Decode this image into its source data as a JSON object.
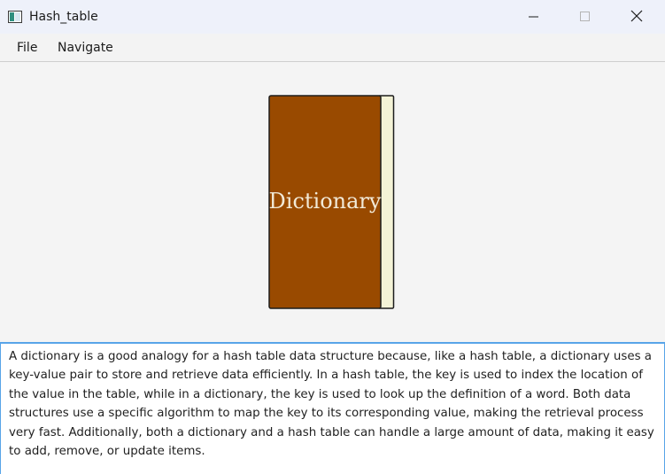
{
  "window": {
    "title": "Hash_table"
  },
  "menu": {
    "items": [
      "File",
      "Navigate"
    ]
  },
  "book": {
    "title": "Dictionary",
    "cover_color": "#994a00",
    "pages_color": "#f4f3d6"
  },
  "description": {
    "text": "A dictionary is a good analogy for a hash table data structure because, like a hash table, a dictionary uses a key-value pair to store and retrieve data efficiently. In a hash table, the key is used to index the location of the value in the table, while in a dictionary, the key is used to look up the definition of a word. Both data structures use a specific algorithm to map the key to its corresponding value, making the retrieval process very fast. Additionally, both a dictionary and a hash table can handle a large amount of data, making it easy to add, remove, or update items."
  },
  "icons": {
    "app": "app-window-icon",
    "minimize": "minimize-icon",
    "maximize": "maximize-icon",
    "close": "close-icon"
  }
}
